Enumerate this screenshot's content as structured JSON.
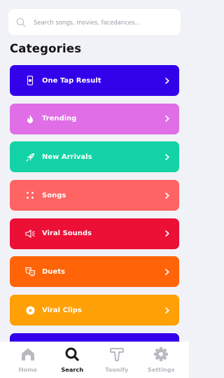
{
  "search": {
    "placeholder": "Search songs, movies, facedances..."
  },
  "heading": "Categories",
  "categories": [
    {
      "label": "One Tap Result",
      "color": "#3300ea",
      "icon": "phone-icon"
    },
    {
      "label": "Trending",
      "color": "#e06ee6",
      "icon": "fire-icon"
    },
    {
      "label": "New Arrivals",
      "color": "#13d3a6",
      "icon": "rocket-icon"
    },
    {
      "label": "Songs",
      "color": "#ff6464",
      "icon": "dots-icon"
    },
    {
      "label": "Viral Sounds",
      "color": "#ec0f36",
      "icon": "speaker-icon"
    },
    {
      "label": "Duets",
      "color": "#ff6508",
      "icon": "duet-masks-icon"
    },
    {
      "label": "Viral Clips",
      "color": "#ffa007",
      "icon": "play-icon"
    },
    {
      "label": "",
      "color": "#3300ea",
      "icon": ""
    }
  ],
  "tabs": [
    {
      "label": "Home",
      "icon": "home-icon",
      "active": false
    },
    {
      "label": "Search",
      "icon": "search-icon",
      "active": true
    },
    {
      "label": "Toonify",
      "icon": "toonify-icon",
      "active": false
    },
    {
      "label": "Settings",
      "icon": "gear-icon",
      "active": false
    }
  ],
  "colors": {
    "active_tab": "#1a1a1a",
    "inactive_tab": "#b9bac0",
    "background": "#f1f2f7"
  }
}
